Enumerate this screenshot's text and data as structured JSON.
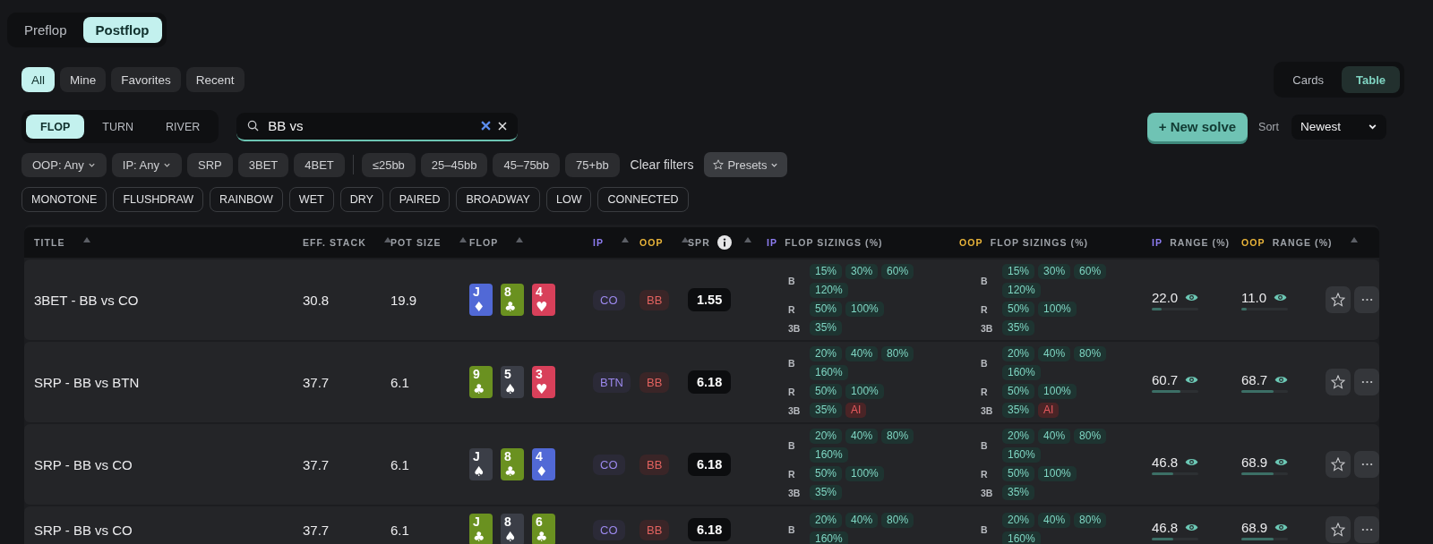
{
  "mode_tabs": [
    {
      "label": "Preflop",
      "selected": false
    },
    {
      "label": "Postflop",
      "selected": true
    }
  ],
  "scope_filters": [
    {
      "label": "All",
      "selected": true
    },
    {
      "label": "Mine",
      "selected": false
    },
    {
      "label": "Favorites",
      "selected": false
    },
    {
      "label": "Recent",
      "selected": false
    }
  ],
  "view_toggle": [
    {
      "label": "Cards",
      "selected": false
    },
    {
      "label": "Table",
      "selected": true
    }
  ],
  "street_tabs": [
    {
      "label": "FLOP",
      "selected": true
    },
    {
      "label": "TURN",
      "selected": false
    },
    {
      "label": "RIVER",
      "selected": false
    }
  ],
  "search": {
    "value": "BB vs"
  },
  "new_solve_button": "+ New solve",
  "sort": {
    "label": "Sort",
    "value": "Newest"
  },
  "position_filters": [
    {
      "label": "OOP: Any",
      "kind": "dropdown",
      "selected": false
    },
    {
      "label": "IP: Any",
      "kind": "dropdown",
      "selected": false
    },
    {
      "label": "SRP",
      "kind": "chip",
      "selected": false
    },
    {
      "label": "3BET",
      "kind": "chip",
      "selected": false
    },
    {
      "label": "4BET",
      "kind": "chip",
      "selected": false
    }
  ],
  "stack_filters": [
    {
      "label": "≤25bb",
      "selected": false
    },
    {
      "label": "25–45bb",
      "selected": false
    },
    {
      "label": "45–75bb",
      "selected": false
    },
    {
      "label": "75+bb",
      "selected": false
    }
  ],
  "clear_filters": "Clear filters",
  "presets": "Presets",
  "texture_filters": [
    {
      "label": "MONOTONE",
      "selected": false
    },
    {
      "label": "FLUSHDRAW",
      "selected": false
    },
    {
      "label": "RAINBOW",
      "selected": false
    },
    {
      "label": "WET",
      "selected": false
    },
    {
      "label": "DRY",
      "selected": false
    },
    {
      "label": "PAIRED",
      "selected": false
    },
    {
      "label": "BROADWAY",
      "selected": false
    },
    {
      "label": "LOW",
      "selected": false
    },
    {
      "label": "CONNECTED",
      "selected": false
    }
  ],
  "table": {
    "columns": [
      {
        "label": "TITLE",
        "kind": "plain",
        "sortable": true
      },
      {
        "label": "EFF. STACK",
        "kind": "plain",
        "sortable": true
      },
      {
        "label": "POT SIZE",
        "kind": "plain",
        "sortable": true
      },
      {
        "label": "FLOP",
        "kind": "plain",
        "sortable": true
      },
      {
        "label": "IP",
        "kind": "ip",
        "sortable": true
      },
      {
        "label": "OOP",
        "kind": "oop",
        "sortable": true
      },
      {
        "label": "SPR",
        "kind": "plain",
        "sortable": true,
        "info": true
      },
      {
        "tag": "IP",
        "label": "FLOP SIZINGS (%)",
        "kind": "ip",
        "sortable": false
      },
      {
        "tag": "OOP",
        "label": "FLOP SIZINGS (%)",
        "kind": "oop",
        "sortable": false
      },
      {
        "tag": "IP",
        "label": "RANGE (%)",
        "kind": "ip",
        "sortable": false
      },
      {
        "tag": "OOP",
        "label": "RANGE (%)",
        "kind": "oop",
        "sortable": true
      }
    ],
    "rows": [
      {
        "title": "3BET - BB vs CO",
        "eff_stack": "30.8",
        "pot_size": "19.9",
        "flop": [
          {
            "rank": "J",
            "suit": "♦",
            "color": "#5169d6"
          },
          {
            "rank": "8",
            "suit": "♣",
            "color": "#6a9120"
          },
          {
            "rank": "4",
            "suit": "♥",
            "color": "#d8405a"
          }
        ],
        "ip": "CO",
        "oop": "BB",
        "spr": "1.55",
        "ip_sizings": [
          {
            "action": "B",
            "sizes": [
              "15%",
              "30%",
              "60%",
              "120%"
            ]
          },
          {
            "action": "R",
            "sizes": [
              "50%",
              "100%"
            ]
          },
          {
            "action": "3B",
            "sizes": [
              "35%"
            ]
          }
        ],
        "oop_sizings": [
          {
            "action": "B",
            "sizes": [
              "15%",
              "30%",
              "60%",
              "120%"
            ]
          },
          {
            "action": "R",
            "sizes": [
              "50%",
              "100%"
            ]
          },
          {
            "action": "3B",
            "sizes": [
              "35%"
            ]
          }
        ],
        "ip_range": {
          "value": "22.0",
          "level": 0.22
        },
        "oop_range": {
          "value": "11.0",
          "level": 0.11
        }
      },
      {
        "title": "SRP - BB vs BTN",
        "eff_stack": "37.7",
        "pot_size": "6.1",
        "flop": [
          {
            "rank": "9",
            "suit": "♣",
            "color": "#6a9120"
          },
          {
            "rank": "5",
            "suit": "♠",
            "color": "#3b3e47"
          },
          {
            "rank": "3",
            "suit": "♥",
            "color": "#d8405a"
          }
        ],
        "ip": "BTN",
        "oop": "BB",
        "spr": "6.18",
        "ip_sizings": [
          {
            "action": "B",
            "sizes": [
              "20%",
              "40%",
              "80%",
              "160%"
            ]
          },
          {
            "action": "R",
            "sizes": [
              "50%",
              "100%"
            ]
          },
          {
            "action": "3B",
            "sizes": [
              "35%"
            ],
            "all_in": "AI"
          }
        ],
        "oop_sizings": [
          {
            "action": "B",
            "sizes": [
              "20%",
              "40%",
              "80%",
              "160%"
            ]
          },
          {
            "action": "R",
            "sizes": [
              "50%",
              "100%"
            ]
          },
          {
            "action": "3B",
            "sizes": [
              "35%"
            ],
            "all_in": "AI"
          }
        ],
        "ip_range": {
          "value": "60.7",
          "level": 0.607
        },
        "oop_range": {
          "value": "68.7",
          "level": 0.687
        }
      },
      {
        "title": "SRP - BB vs CO",
        "eff_stack": "37.7",
        "pot_size": "6.1",
        "flop": [
          {
            "rank": "J",
            "suit": "♠",
            "color": "#3b3e47"
          },
          {
            "rank": "8",
            "suit": "♣",
            "color": "#6a9120"
          },
          {
            "rank": "4",
            "suit": "♦",
            "color": "#5169d6"
          }
        ],
        "ip": "CO",
        "oop": "BB",
        "spr": "6.18",
        "ip_sizings": [
          {
            "action": "B",
            "sizes": [
              "20%",
              "40%",
              "80%",
              "160%"
            ]
          },
          {
            "action": "R",
            "sizes": [
              "50%",
              "100%"
            ]
          },
          {
            "action": "3B",
            "sizes": [
              "35%"
            ]
          }
        ],
        "oop_sizings": [
          {
            "action": "B",
            "sizes": [
              "20%",
              "40%",
              "80%",
              "160%"
            ]
          },
          {
            "action": "R",
            "sizes": [
              "50%",
              "100%"
            ]
          },
          {
            "action": "3B",
            "sizes": [
              "35%"
            ]
          }
        ],
        "ip_range": {
          "value": "46.8",
          "level": 0.468
        },
        "oop_range": {
          "value": "68.9",
          "level": 0.689
        }
      },
      {
        "title": "SRP - BB vs CO",
        "eff_stack": "37.7",
        "pot_size": "6.1",
        "flop": [
          {
            "rank": "J",
            "suit": "♣",
            "color": "#6a9120"
          },
          {
            "rank": "8",
            "suit": "♠",
            "color": "#3b3e47"
          },
          {
            "rank": "6",
            "suit": "♣",
            "color": "#6a9120"
          }
        ],
        "ip": "CO",
        "oop": "BB",
        "spr": "6.18",
        "ip_sizings": [
          {
            "action": "B",
            "sizes": [
              "20%",
              "40%",
              "80%",
              "160%"
            ]
          }
        ],
        "oop_sizings": [
          {
            "action": "B",
            "sizes": [
              "20%",
              "40%",
              "80%",
              "160%"
            ]
          }
        ],
        "ip_range": {
          "value": "46.8",
          "level": 0.468
        },
        "oop_range": {
          "value": "68.9",
          "level": 0.689
        }
      }
    ]
  }
}
